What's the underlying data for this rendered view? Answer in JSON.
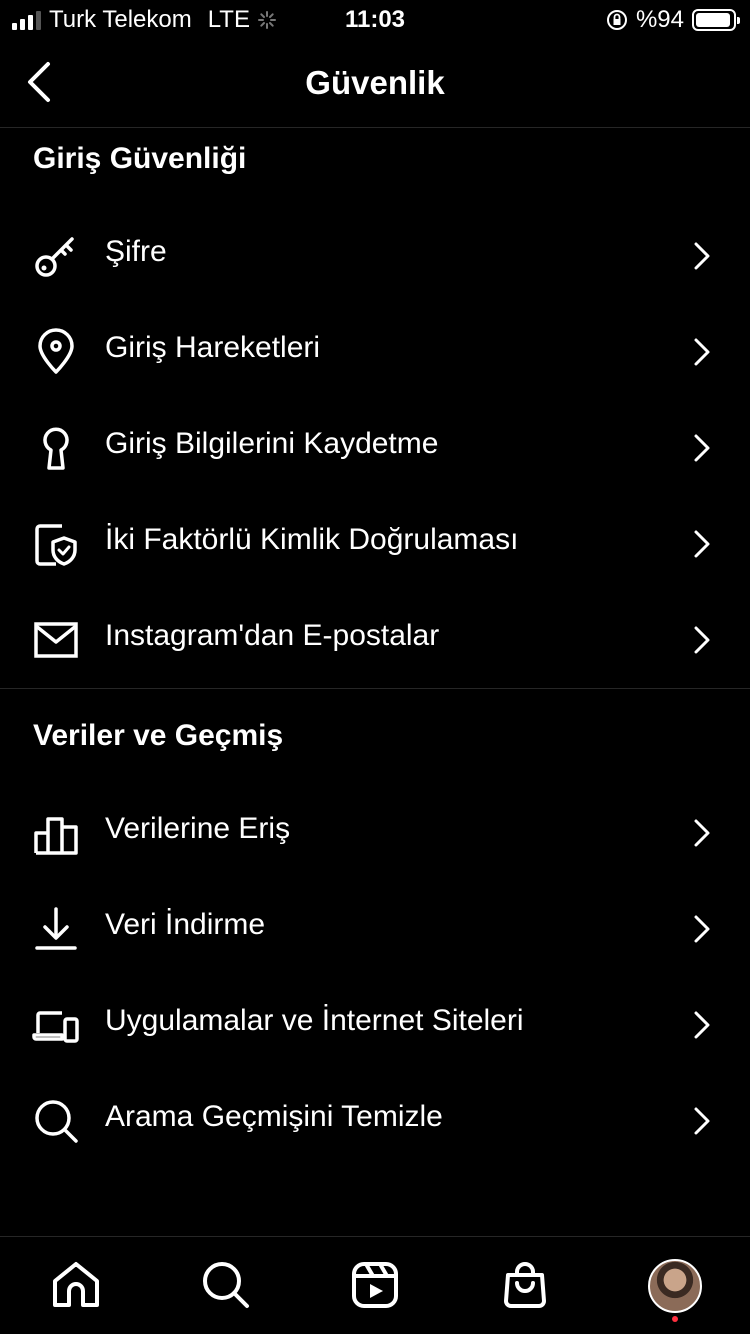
{
  "status_bar": {
    "carrier": "Turk Telekom",
    "network": "LTE",
    "time": "11:03",
    "battery_text": "%94",
    "battery_level": 0.94
  },
  "header": {
    "title": "Güvenlik",
    "back_icon": "chevron-left-icon"
  },
  "sections": {
    "login": {
      "title": "Giriş Güvenliği",
      "items": [
        {
          "label": "Şifre",
          "icon": "key-icon"
        },
        {
          "label": "Giriş Hareketleri",
          "icon": "location-pin-icon"
        },
        {
          "label": "Giriş Bilgilerini Kaydetme",
          "icon": "keyhole-icon"
        },
        {
          "label": "İki Faktörlü Kimlik Doğrulaması",
          "icon": "shield-check-icon"
        },
        {
          "label": "Instagram'dan E-postalar",
          "icon": "mail-icon"
        }
      ]
    },
    "data": {
      "title": "Veriler ve Geçmiş",
      "items": [
        {
          "label": "Verilerine Eriş",
          "icon": "bar-chart-icon"
        },
        {
          "label": "Veri İndirme",
          "icon": "download-icon"
        },
        {
          "label": "Uygulamalar ve İnternet Siteleri",
          "icon": "devices-icon"
        },
        {
          "label": "Arama Geçmişini Temizle",
          "icon": "search-icon"
        }
      ]
    }
  },
  "tab_bar": {
    "tabs": [
      "home-icon",
      "search-icon",
      "reels-icon",
      "shop-icon",
      "profile-avatar"
    ],
    "notification_color": "#ff3040"
  }
}
